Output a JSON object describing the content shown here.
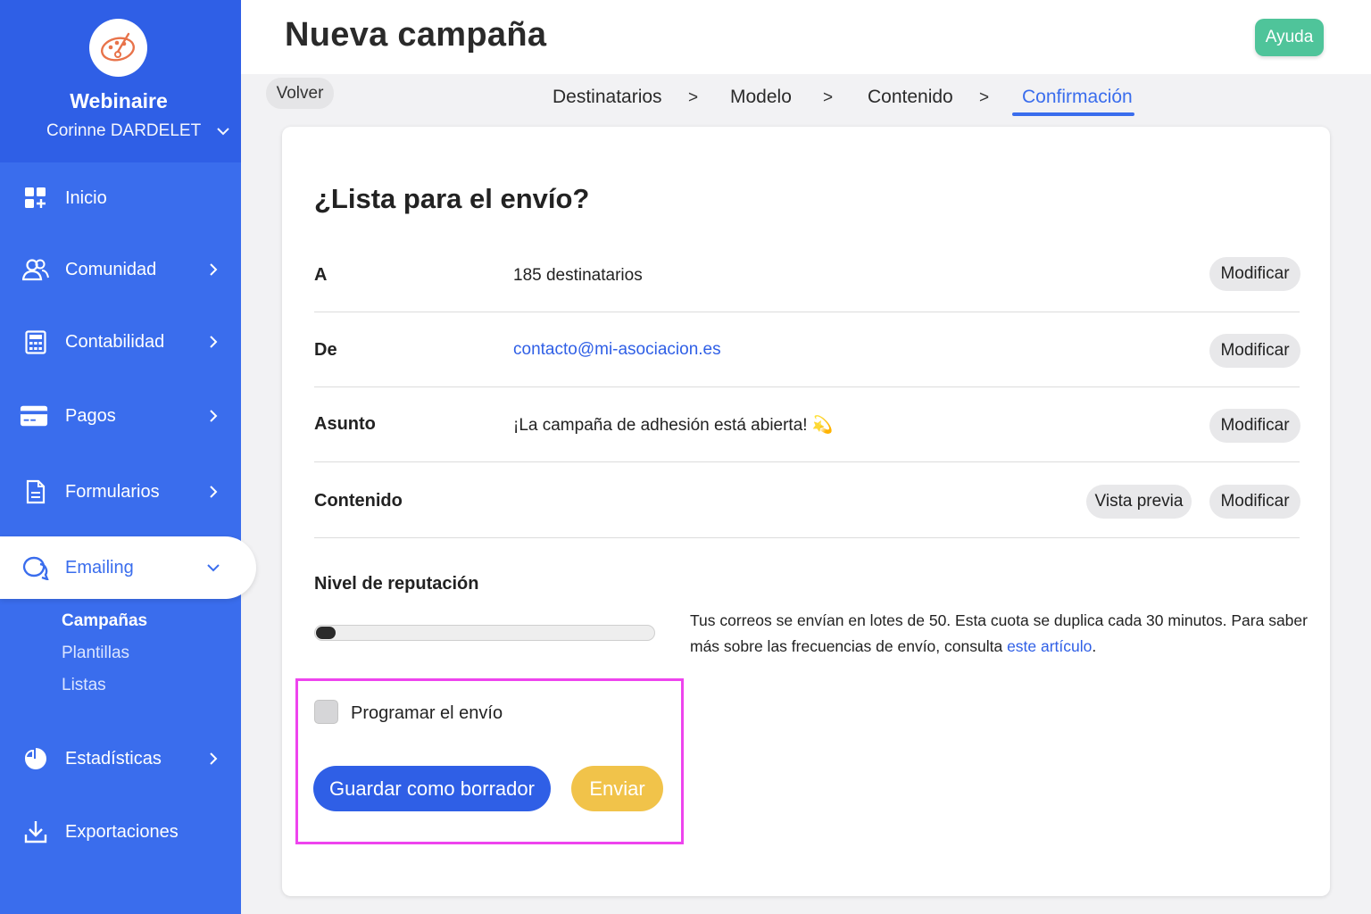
{
  "app": {
    "org_name": "Webinaire",
    "user_name": "Corinne DARDELET"
  },
  "sidebar": {
    "items": [
      {
        "label": "Inicio",
        "icon": "dashboard-icon"
      },
      {
        "label": "Comunidad",
        "icon": "users-icon"
      },
      {
        "label": "Contabilidad",
        "icon": "calculator-icon"
      },
      {
        "label": "Pagos",
        "icon": "credit-card-icon"
      },
      {
        "label": "Formularios",
        "icon": "document-icon"
      },
      {
        "label": "Emailing",
        "icon": "chat-icon"
      },
      {
        "label": "Estadísticas",
        "icon": "pie-chart-icon"
      },
      {
        "label": "Exportaciones",
        "icon": "download-icon"
      }
    ],
    "emailing_sub": [
      "Campañas",
      "Plantillas",
      "Listas"
    ]
  },
  "header": {
    "title": "Nueva campaña",
    "help_label": "Ayuda"
  },
  "stepper": {
    "back_label": "Volver",
    "steps": [
      "Destinatarios",
      "Modelo",
      "Contenido",
      "Confirmación"
    ],
    "separator": ">",
    "current": "Confirmación"
  },
  "summary": {
    "title": "¿Lista para el envío?",
    "rows": [
      {
        "label": "A",
        "value": "185 destinatarios"
      },
      {
        "label": "De",
        "value": "contacto@mi-asociacion.es"
      },
      {
        "label": "Asunto",
        "value": "¡La campaña de adhesión está abierta! 💫"
      },
      {
        "label": "Contenido",
        "value": ""
      }
    ],
    "modify_label": "Modificar",
    "preview_label": "Vista previa"
  },
  "reputation": {
    "title": "Nivel de reputación",
    "level": 0.04,
    "text_before": "Tus correos se envían en lotes de 50. Esta cuota se duplica cada 30 minutos. Para saber más sobre las frecuencias de envío, consulta ",
    "link_text": "este artículo",
    "text_after": "."
  },
  "actions": {
    "schedule_label": "Programar el envío",
    "schedule_checked": false,
    "draft_label": "Guardar como borrador",
    "send_label": "Enviar"
  },
  "colors": {
    "sidebar": "#3a6ded",
    "primary": "#2f5fe6",
    "help": "#4fc49a",
    "send": "#f1c34a",
    "highlight": "#ee44ee"
  }
}
